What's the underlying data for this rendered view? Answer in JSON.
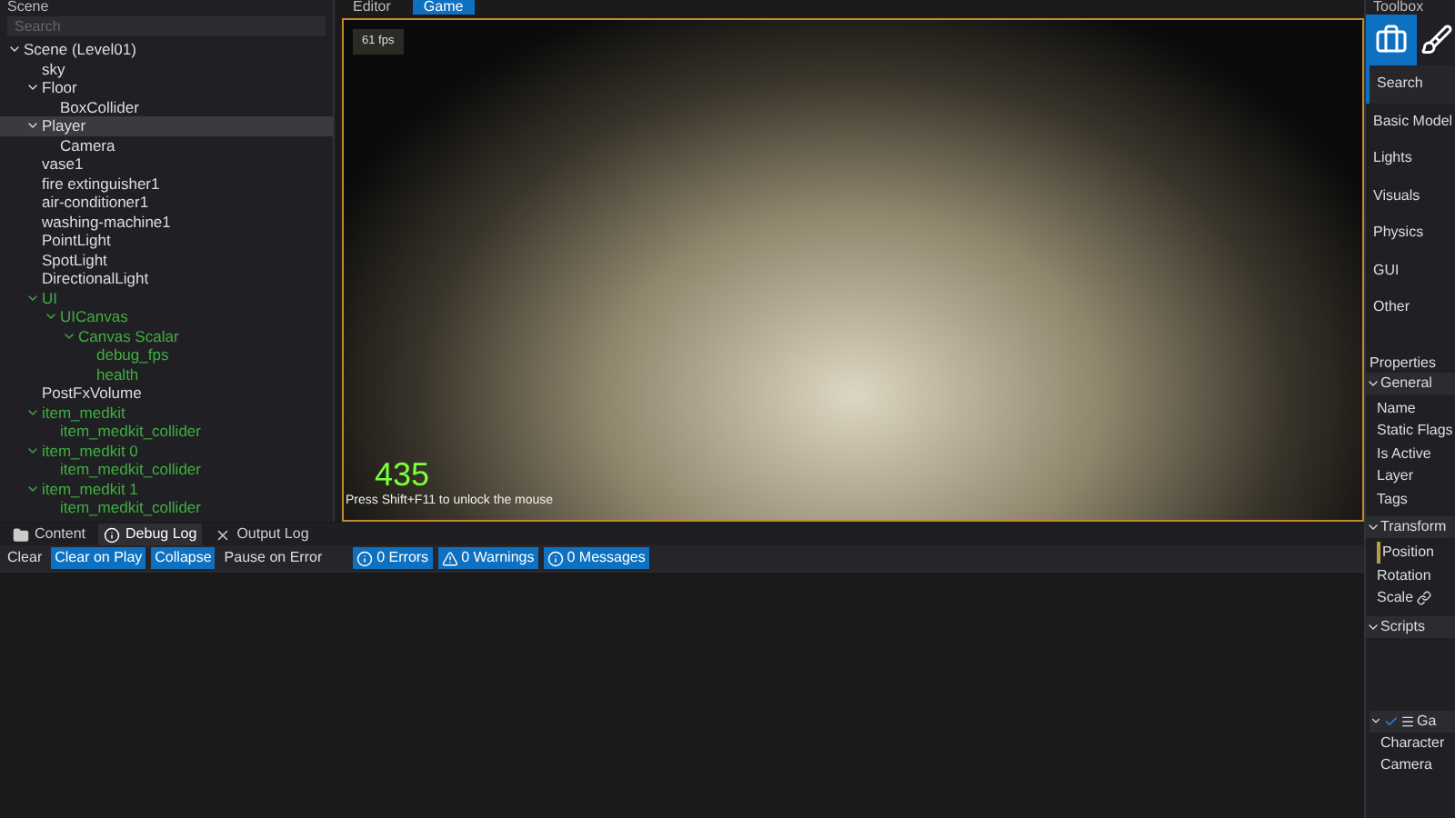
{
  "scene_panel": {
    "title": "Scene",
    "search": {
      "placeholder": "Search"
    },
    "tree": [
      {
        "label": "Scene (Level01)",
        "color": "#dddddd",
        "expanded": true,
        "selected": false,
        "children": [
          {
            "label": "sky",
            "color": "#dddddd",
            "selected": false
          },
          {
            "label": "Floor",
            "color": "#dddddd",
            "expanded": true,
            "selected": false,
            "children": [
              {
                "label": "BoxCollider",
                "color": "#dddddd",
                "selected": false
              }
            ]
          },
          {
            "label": "Player",
            "color": "#dddddd",
            "expanded": true,
            "selected": true,
            "children": [
              {
                "label": "Camera",
                "color": "#dddddd",
                "selected": false
              }
            ]
          },
          {
            "label": "vase1",
            "color": "#dddddd",
            "selected": false
          },
          {
            "label": "fire extinguisher1",
            "color": "#dddddd",
            "selected": false
          },
          {
            "label": "air-conditioner1",
            "color": "#dddddd",
            "selected": false
          },
          {
            "label": "washing-machine1",
            "color": "#dddddd",
            "selected": false
          },
          {
            "label": "PointLight",
            "color": "#dddddd",
            "selected": false
          },
          {
            "label": "SpotLight",
            "color": "#dddddd",
            "selected": false
          },
          {
            "label": "DirectionalLight",
            "color": "#dddddd",
            "selected": false
          },
          {
            "label": "UI",
            "color": "#3fae3f",
            "expanded": true,
            "selected": false,
            "children": [
              {
                "label": "UICanvas",
                "color": "#3fae3f",
                "expanded": true,
                "selected": false,
                "children": [
                  {
                    "label": "Canvas Scalar",
                    "color": "#3fae3f",
                    "expanded": true,
                    "selected": false,
                    "children": [
                      {
                        "label": "debug_fps",
                        "color": "#3fae3f",
                        "selected": false
                      },
                      {
                        "label": "health",
                        "color": "#3fae3f",
                        "selected": false
                      }
                    ]
                  }
                ]
              }
            ]
          },
          {
            "label": "PostFxVolume",
            "color": "#dddddd",
            "selected": false
          },
          {
            "label": "item_medkit",
            "color": "#3fae3f",
            "expanded": true,
            "selected": false,
            "children": [
              {
                "label": "item_medkit_collider",
                "color": "#3fae3f",
                "selected": false
              }
            ]
          },
          {
            "label": "item_medkit 0",
            "color": "#3fae3f",
            "expanded": true,
            "selected": false,
            "children": [
              {
                "label": "item_medkit_collider",
                "color": "#3fae3f",
                "selected": false
              }
            ]
          },
          {
            "label": "item_medkit 1",
            "color": "#3fae3f",
            "expanded": true,
            "selected": false,
            "children": [
              {
                "label": "item_medkit_collider",
                "color": "#3fae3f",
                "selected": false
              }
            ]
          }
        ]
      }
    ]
  },
  "editor_tabs": [
    {
      "label": "Editor",
      "selected": false
    },
    {
      "label": "Game",
      "selected": true
    }
  ],
  "game_view": {
    "fps": "61 fps",
    "health": "435",
    "hint": "Press Shift+F11 to unlock the mouse"
  },
  "bottom_tabs": [
    {
      "label": "Content",
      "selected": false
    },
    {
      "label": "Debug Log",
      "selected": true
    },
    {
      "label": "Output Log",
      "selected": false
    }
  ],
  "log_toolbar": [
    {
      "label": "Clear",
      "selected": false
    },
    {
      "label": "Clear on Play",
      "selected": true
    },
    {
      "label": "Collapse",
      "selected": true
    },
    {
      "label": "Pause on Error",
      "selected": false
    },
    {
      "label": "0 Errors",
      "selected": true
    },
    {
      "label": "0 Warnings",
      "selected": true
    },
    {
      "label": "0 Messages",
      "selected": true
    }
  ],
  "toolbox": {
    "title": "Toolbox",
    "categories": [
      {
        "label": "Search",
        "selected": true
      },
      {
        "label": "Basic Model",
        "selected": false
      },
      {
        "label": "Lights",
        "selected": false
      },
      {
        "label": "Visuals",
        "selected": false
      },
      {
        "label": "Physics",
        "selected": false
      },
      {
        "label": "GUI",
        "selected": false
      },
      {
        "label": "Other",
        "selected": false
      }
    ]
  },
  "properties": {
    "title": "Properties",
    "sections": [
      {
        "title": "General",
        "expanded": true,
        "fields": [
          "Name",
          "Static Flags",
          "Is Active",
          "Layer",
          "Tags"
        ]
      },
      {
        "title": "Transform",
        "expanded": true,
        "fields": [
          "Position",
          "Rotation",
          "Scale"
        ]
      },
      {
        "title": "Scripts",
        "expanded": true
      }
    ],
    "script": {
      "title": "Ga",
      "checked": true,
      "fields": [
        "Character",
        "Camera"
      ]
    }
  }
}
